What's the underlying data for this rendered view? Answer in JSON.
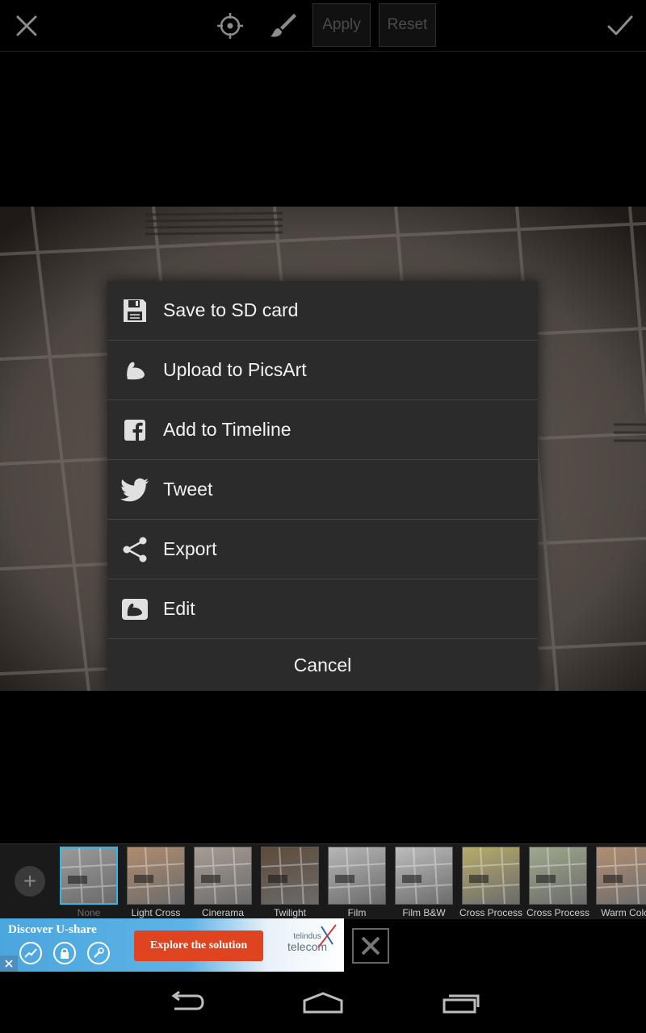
{
  "toolbar": {
    "apply_label": "Apply",
    "reset_label": "Reset",
    "icons": [
      "close-icon",
      "target-icon",
      "brush-icon",
      "checkmark-icon"
    ]
  },
  "menu": {
    "items": [
      {
        "label": "Save to SD card",
        "icon": "sd-card-icon"
      },
      {
        "label": "Upload to PicsArt",
        "icon": "picsart-icon"
      },
      {
        "label": "Add to Timeline",
        "icon": "facebook-icon"
      },
      {
        "label": "Tweet",
        "icon": "twitter-icon"
      },
      {
        "label": "Export",
        "icon": "share-icon"
      },
      {
        "label": "Edit",
        "icon": "edit-photo-icon"
      }
    ],
    "cancel_label": "Cancel"
  },
  "filters": {
    "items": [
      {
        "label": "None",
        "selected": true,
        "tint": "#9a9a9a"
      },
      {
        "label": "Light Cross",
        "tint": "#b08c6e"
      },
      {
        "label": "Cinerama",
        "tint": "#a89c94"
      },
      {
        "label": "Twilight",
        "tint": "#5e4b3a"
      },
      {
        "label": "Film",
        "tint": "#b7b7b7"
      },
      {
        "label": "Film B&W",
        "tint": "#bdbdbd"
      },
      {
        "label": "Cross Process",
        "tint": "#b7ab6a"
      },
      {
        "label": "Cross Process",
        "tint": "#9ea98c"
      },
      {
        "label": "Warm Colo",
        "tint": "#b28f72"
      }
    ]
  },
  "ad": {
    "headline": "Discover U-share",
    "cta": "Explore the solution",
    "brand_line1": "telindus",
    "brand_line2": "telecom"
  },
  "colors": {
    "dialog_bg": "#2b2b2b",
    "selected_filter": "#33b5e5",
    "ad_cta": "#e0431f"
  }
}
